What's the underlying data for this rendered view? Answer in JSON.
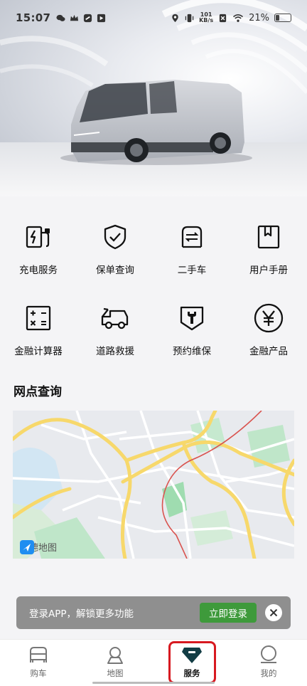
{
  "status_bar": {
    "time": "15:07",
    "net_speed_value": "101",
    "net_speed_unit": "KB/s",
    "battery": "21%",
    "battery_level": 0.21
  },
  "services": [
    {
      "label": "充电服务",
      "icon": "charging-station-icon"
    },
    {
      "label": "保单查询",
      "icon": "shield-check-icon"
    },
    {
      "label": "二手车",
      "icon": "exchange-car-icon"
    },
    {
      "label": "用户手册",
      "icon": "book-icon"
    },
    {
      "label": "金融计算器",
      "icon": "calculator-icon"
    },
    {
      "label": "道路救援",
      "icon": "tow-truck-icon"
    },
    {
      "label": "预约维保",
      "icon": "wrench-shield-icon"
    },
    {
      "label": "金融产品",
      "icon": "yen-icon"
    }
  ],
  "section": {
    "title": "网点查询"
  },
  "map": {
    "logo_text": "高德地图"
  },
  "login_banner": {
    "text": "登录APP，解锁更多功能",
    "button": "立即登录"
  },
  "bottom_nav": [
    {
      "label": "购车",
      "icon": "car-front-icon",
      "active": false
    },
    {
      "label": "地图",
      "icon": "map-pin-icon",
      "active": false
    },
    {
      "label": "服务",
      "icon": "service-diamond-icon",
      "active": true
    },
    {
      "label": "我的",
      "icon": "profile-icon",
      "active": false
    }
  ],
  "colors": {
    "accent_green": "#3e9a3b",
    "highlight_red": "#d71920",
    "service_dark": "#123c44"
  }
}
